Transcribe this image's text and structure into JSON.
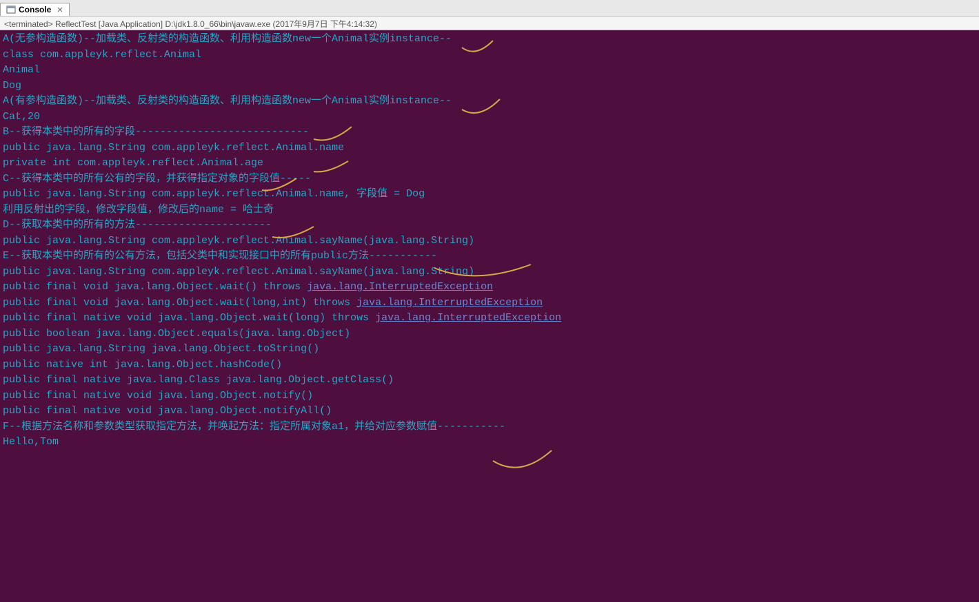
{
  "tab": {
    "label": "Console",
    "close": "✕"
  },
  "status": "<terminated> ReflectTest [Java Application] D:\\jdk1.8.0_66\\bin\\javaw.exe (2017年9月7日 下午4:14:32)",
  "lines": [
    {
      "text": "A(无参构造函数)--加载类、反射类的构造函数、利用构造函数new一个Animal实例instance--"
    },
    {
      "text": "class com.appleyk.reflect.Animal"
    },
    {
      "text": "Animal"
    },
    {
      "text": "Dog"
    },
    {
      "text": "A(有参构造函数)--加载类、反射类的构造函数、利用构造函数new一个Animal实例instance--"
    },
    {
      "text": "Cat,20"
    },
    {
      "text": "B--获得本类中的所有的字段----------------------------"
    },
    {
      "text": "public java.lang.String com.appleyk.reflect.Animal.name"
    },
    {
      "text": "private int com.appleyk.reflect.Animal.age"
    },
    {
      "text": "C--获得本类中的所有公有的字段，并获得指定对象的字段值-----"
    },
    {
      "text": "public java.lang.String com.appleyk.reflect.Animal.name, 字段值 = Dog"
    },
    {
      "text": "利用反射出的字段，修改字段值，修改后的name = 哈士奇"
    },
    {
      "text": "D--获取本类中的所有的方法----------------------"
    },
    {
      "text": "public java.lang.String com.appleyk.reflect.Animal.sayName(java.lang.String)"
    },
    {
      "text": "E--获取本类中的所有的公有方法，包括父类中和实现接口中的所有public方法-----------"
    },
    {
      "text": "public java.lang.String com.appleyk.reflect.Animal.sayName(java.lang.String)"
    },
    {
      "pre": "public final void java.lang.Object.wait() throws ",
      "link": "java.lang.InterruptedException"
    },
    {
      "pre": "public final void java.lang.Object.wait(long,int) throws ",
      "link": "java.lang.InterruptedException"
    },
    {
      "pre": "public final native void java.lang.Object.wait(long) throws ",
      "link": "java.lang.InterruptedException"
    },
    {
      "text": "public boolean java.lang.Object.equals(java.lang.Object)"
    },
    {
      "text": "public java.lang.String java.lang.Object.toString()"
    },
    {
      "text": "public native int java.lang.Object.hashCode()"
    },
    {
      "text": "public final native java.lang.Class java.lang.Object.getClass()"
    },
    {
      "text": "public final native void java.lang.Object.notify()"
    },
    {
      "text": "public final native void java.lang.Object.notifyAll()"
    },
    {
      "text": "F--根据方法名称和参数类型获取指定方法，并唤起方法：指定所属对象a1，并给对应参数赋值-----------"
    },
    {
      "text": "Hello,Tom"
    }
  ]
}
